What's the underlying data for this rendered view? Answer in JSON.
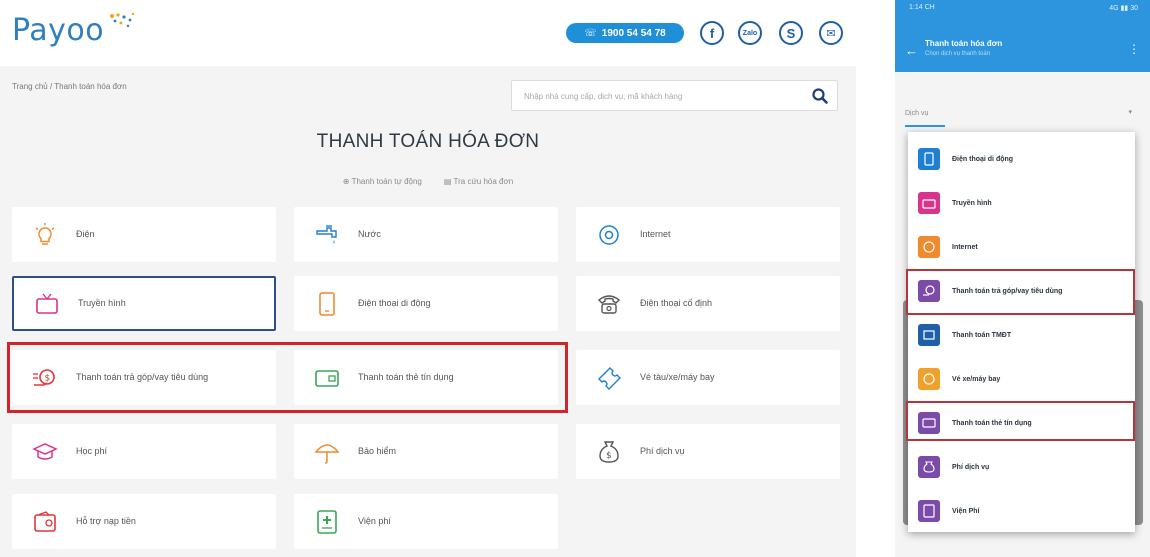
{
  "header": {
    "logo_text": "Payoo",
    "hotline": "1900 54 54 78",
    "social": {
      "facebook": "f",
      "zalo": "Zalo",
      "skype": "S",
      "mail": "✉"
    }
  },
  "breadcrumb": {
    "text": "Trang chủ  /  Thanh toán hóa đơn"
  },
  "search": {
    "placeholder": "Nhập nhà cung cấp, dịch vụ, mã khách hàng"
  },
  "page": {
    "title": "THANH TOÁN HÓA ĐƠN",
    "link_auto": "Thanh toán tự động",
    "link_lookup": "Tra cứu hóa đơn"
  },
  "services": [
    {
      "label": "Điện",
      "icon": "bulb-icon"
    },
    {
      "label": "Nước",
      "icon": "faucet-icon"
    },
    {
      "label": "Internet",
      "icon": "at-icon"
    },
    {
      "label": "Truyền hình",
      "icon": "tv-icon"
    },
    {
      "label": "Điện thoại di động",
      "icon": "mobile-icon"
    },
    {
      "label": "Điện thoại cố định",
      "icon": "landline-icon"
    },
    {
      "label": "Thanh toán trả góp/vay tiêu dùng",
      "icon": "loan-icon"
    },
    {
      "label": "Thanh toán thẻ tín dụng",
      "icon": "credit-card-icon"
    },
    {
      "label": "Vé tàu/xe/máy bay",
      "icon": "ticket-icon"
    },
    {
      "label": "Học phí",
      "icon": "graduation-icon"
    },
    {
      "label": "Bảo hiểm",
      "icon": "umbrella-icon"
    },
    {
      "label": "Phí dịch vụ",
      "icon": "fee-icon"
    },
    {
      "label": "Hỗ trợ nạp tiền",
      "icon": "wallet-icon"
    },
    {
      "label": "Viện phí",
      "icon": "hospital-icon"
    }
  ],
  "phone": {
    "status_time": "1:14 CH",
    "status_right": "4G ▮▮ 30",
    "app_title": "Thanh toán hóa đơn",
    "app_subtitle": "Chọn dịch vụ thanh toán",
    "field_label": "Dịch vụ",
    "dropdown": [
      {
        "label": "Điện thoại di động",
        "color": "#1f7fd1"
      },
      {
        "label": "Truyền hình",
        "color": "#d9348b"
      },
      {
        "label": "Internet",
        "color": "#f08a2c"
      },
      {
        "label": "Thanh toán trả góp/vay tiêu dùng",
        "color": "#7c4aa8"
      },
      {
        "label": "Thanh toán TMĐT",
        "color": "#1f5fa8"
      },
      {
        "label": "Vé xe/máy bay",
        "color": "#f0a12c"
      },
      {
        "label": "Thanh toán thẻ tín dụng",
        "color": "#7c4aa8"
      },
      {
        "label": "Phí dịch vụ",
        "color": "#7c4aa8"
      },
      {
        "label": "Viện Phí",
        "color": "#7c4aa8"
      }
    ]
  },
  "colors": {
    "brand_blue": "#2f7fc1",
    "highlight_red": "#d0232a",
    "icon_red": "#e5353b",
    "icon_orange": "#f08a2c",
    "icon_blue": "#1f7fd1"
  }
}
